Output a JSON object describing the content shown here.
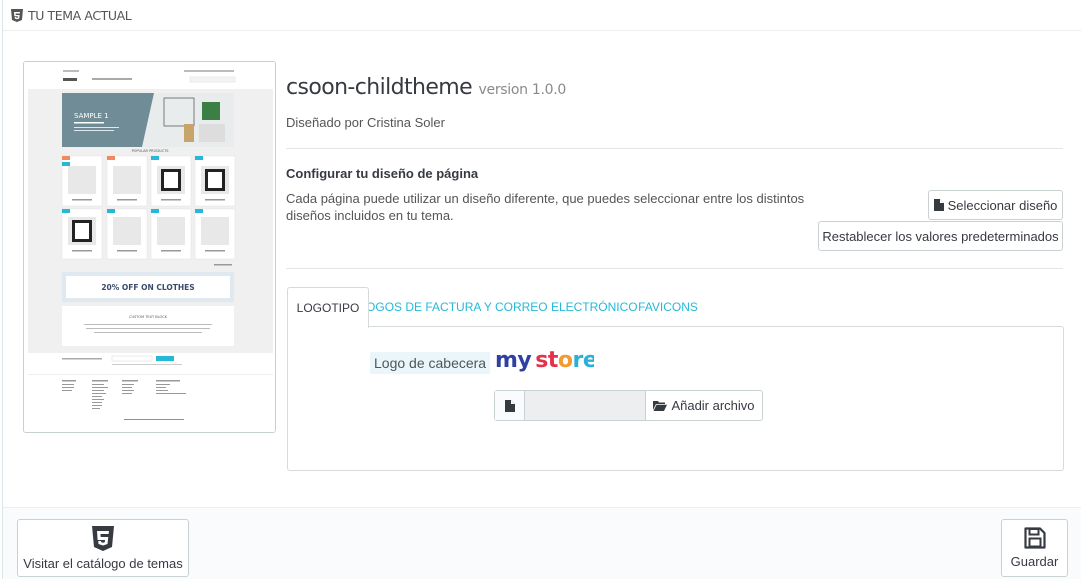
{
  "panel": {
    "title": "TU TEMA ACTUAL"
  },
  "theme": {
    "name": "csoon-childtheme",
    "version": "version 1.0.0",
    "designer": "Diseñado por Cristina Soler"
  },
  "layout_section": {
    "title": "Configurar tu diseño de página",
    "description": "Cada página puede utilizar un diseño diferente, que puedes seleccionar entre los distintos diseños incluidos en tu tema.",
    "select_button": "Seleccionar diseño",
    "reset_button": "Restablecer los valores predeterminados"
  },
  "tabs": [
    {
      "label": "LOGOTIPO",
      "active": true
    },
    {
      "label": "LOGOS DE FACTURA Y CORREO ELECTRÓNICO",
      "active": false
    },
    {
      "label": "FAVICONS",
      "active": false
    }
  ],
  "logo_tab": {
    "header_logo_label": "Logo de cabecera",
    "logo_text": "my store",
    "add_file_button": "Añadir archivo"
  },
  "footer": {
    "catalog_button": "Visitar el catálogo de temas",
    "save_button": "Guardar"
  },
  "preview": {
    "banner_title": "SAMPLE 1",
    "section_title": "POPULAR PRODUCTS",
    "promo_text": "20% OFF ON CLOTHES",
    "custom_block_title": "CUSTOM TEXT BLOCK"
  },
  "colors": {
    "accent": "#25b9d7",
    "text": "#363a41",
    "border": "#c9d1d3"
  }
}
